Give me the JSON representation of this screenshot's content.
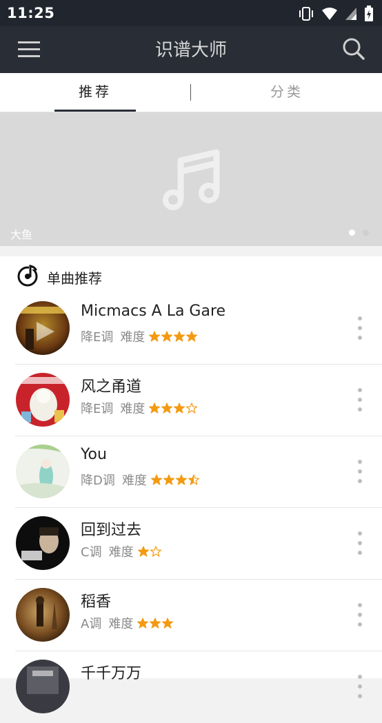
{
  "status_bar": {
    "time": "11:25",
    "icons": [
      "vibrate-icon",
      "wifi-icon",
      "signal-icon",
      "battery-charging-icon"
    ]
  },
  "app_bar": {
    "title": "识谱大师",
    "menu_icon": "hamburger-menu-icon",
    "search_icon": "search-icon"
  },
  "tabs": [
    {
      "label": "推荐",
      "active": true
    },
    {
      "label": "分类",
      "active": false
    }
  ],
  "banner": {
    "caption": "大鱼",
    "icon": "music-note-icon",
    "page_count": 2,
    "current_page": 1
  },
  "section": {
    "icon": "music-disc-icon",
    "title": "单曲推荐"
  },
  "songs": [
    {
      "title": "Micmacs A La Gare",
      "key": "降E调",
      "difficulty_label": "难度",
      "rating": 4,
      "max_rating": 4
    },
    {
      "title": "风之甬道",
      "key": "降E调",
      "difficulty_label": "难度",
      "rating": 3,
      "max_rating": 4
    },
    {
      "title": "You",
      "key": "降D调",
      "difficulty_label": "难度",
      "rating": 3.5,
      "max_rating": 4
    },
    {
      "title": "回到过去",
      "key": "C调",
      "difficulty_label": "难度",
      "rating": 1,
      "max_rating": 2
    },
    {
      "title": "稻香",
      "key": "A调",
      "difficulty_label": "难度",
      "rating": 3,
      "max_rating": 3
    },
    {
      "title": "千千万万",
      "key": "",
      "difficulty_label": "",
      "rating": 0,
      "max_rating": 0
    }
  ],
  "colors": {
    "status_bar": "#21252e",
    "app_bar": "#292d35",
    "star": "#f39a12",
    "tab_indicator": "#292d35"
  }
}
